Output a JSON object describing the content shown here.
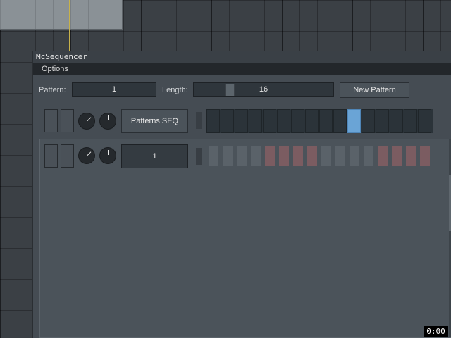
{
  "window": {
    "title": "McSequencer"
  },
  "menu": {
    "options": "Options"
  },
  "toolbar": {
    "pattern_label": "Pattern:",
    "pattern_value": "1",
    "length_label": "Length:",
    "length_value": "16",
    "length_slider_fraction": 0.2,
    "new_pattern_label": "New Pattern"
  },
  "tracks": [
    {
      "name": "Patterns SEQ",
      "steps": [
        0,
        0,
        0,
        0,
        0,
        0,
        0,
        0,
        0,
        0,
        1,
        0,
        0,
        0,
        0,
        0
      ]
    },
    {
      "name": "1",
      "steps": [
        0,
        0,
        0,
        0,
        1,
        1,
        1,
        1,
        0,
        0,
        0,
        0,
        1,
        1,
        1,
        1
      ]
    }
  ],
  "status": {
    "timer": "0:00"
  },
  "colors": {
    "accent_step": "#6aa4d6",
    "pattern_accent": "#7b5c61",
    "playhead": "#c8b24a"
  }
}
